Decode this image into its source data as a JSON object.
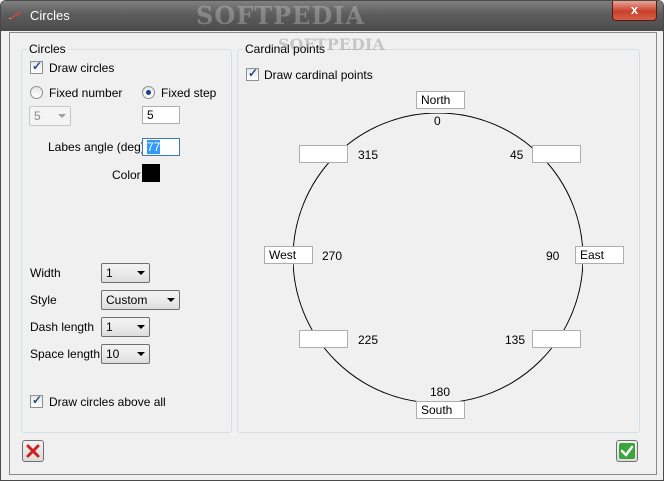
{
  "window": {
    "title": "Circles",
    "watermark": "SOFTPEDIA",
    "close_label": "x"
  },
  "circles_group": {
    "label": "Circles",
    "draw_circles": {
      "label": "Draw circles",
      "checked": true
    },
    "fixed_number": {
      "label": "Fixed number",
      "selected": false
    },
    "fixed_step": {
      "label": "Fixed step",
      "selected": true
    },
    "number_select": {
      "value": "5"
    },
    "step_value": "5",
    "labels_angle": {
      "label": "Labes angle (deg)",
      "value": "77"
    },
    "color": {
      "label": "Color",
      "value": "#000000"
    },
    "width": {
      "label": "Width",
      "value": "1"
    },
    "style": {
      "label": "Style",
      "value": "Custom"
    },
    "dash_length": {
      "label": "Dash length",
      "value": "1"
    },
    "space_length": {
      "label": "Space length",
      "value": "10"
    },
    "draw_above": {
      "label": "Draw circles above all",
      "checked": true
    }
  },
  "cardinal_group": {
    "label": "Cardinal points",
    "watermark": "SOFTPEDIA",
    "draw_cardinal": {
      "label": "Draw cardinal points",
      "checked": true
    },
    "north": {
      "field": "North",
      "angle": "0"
    },
    "ne": {
      "field": "",
      "angle": "45"
    },
    "east": {
      "field": "East",
      "angle": "90"
    },
    "se": {
      "field": "",
      "angle": "135"
    },
    "south": {
      "field": "South",
      "angle": "180"
    },
    "sw": {
      "field": "",
      "angle": "225"
    },
    "west": {
      "field": "West",
      "angle": "270"
    },
    "nw": {
      "field": "",
      "angle": "315"
    }
  },
  "footer": {
    "cancel_icon": "red-x-icon",
    "ok_icon": "green-check-icon"
  }
}
